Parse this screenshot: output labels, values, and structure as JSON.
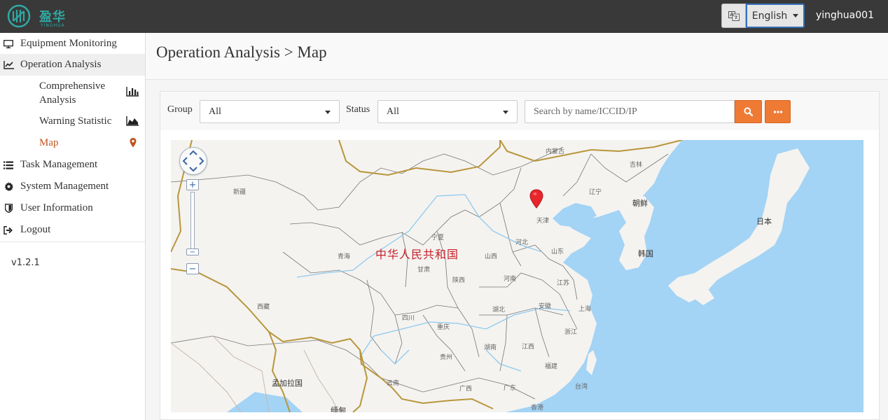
{
  "header": {
    "logo_text": "盈华",
    "logo_sub": "YINGHUA",
    "language": "English",
    "username": "yinghua001"
  },
  "sidebar": {
    "items": [
      {
        "label": "Equipment Monitoring",
        "icon": "monitor-icon"
      },
      {
        "label": "Operation Analysis",
        "icon": "line-chart-icon"
      },
      {
        "label": "Task Management",
        "icon": "list-icon"
      },
      {
        "label": "System Management",
        "icon": "gear-icon"
      },
      {
        "label": "User Information",
        "icon": "shield-icon"
      },
      {
        "label": "Logout",
        "icon": "sign-out-icon"
      }
    ],
    "sub_items": [
      {
        "label": "Comprehensive Analysis",
        "icon": "bar-chart-icon"
      },
      {
        "label": "Warning Statistic",
        "icon": "area-chart-icon"
      },
      {
        "label": "Map",
        "icon": "map-marker-icon"
      }
    ],
    "version": "v1.2.1"
  },
  "page": {
    "title": "Operation Analysis > Map"
  },
  "filters": {
    "group_label": "Group",
    "group_value": "All",
    "status_label": "Status",
    "status_value": "All",
    "search_placeholder": "Search by name/ICCID/IP"
  },
  "map": {
    "country_label": "中华人民共和国",
    "labels": {
      "neimenggu": "内蒙古",
      "jilin": "吉林",
      "liaoning": "辽宁",
      "chaoxian": "朝鲜",
      "xinjiang": "新疆",
      "tianjin": "天津",
      "ningxia": "宁夏",
      "riben": "日本",
      "qinghai": "青海",
      "hebei": "河北",
      "shandong": "山东",
      "hanguo": "韩国",
      "shanxi": "山西",
      "gansu": "甘肃",
      "shaanxi": "陕西",
      "henan": "河南",
      "jiangsu": "江苏",
      "xizang": "西藏",
      "anhui": "安徽",
      "hubei": "湖北",
      "shanghai": "上海",
      "sichuan": "四川",
      "chongqing": "重庆",
      "zhejiang": "浙江",
      "hunan": "湖南",
      "jiangxi": "江西",
      "guizhou": "贵州",
      "fujian": "福建",
      "mengjiala": "孟加拉国",
      "yunnan": "云南",
      "guangxi": "广西",
      "guangdong": "广东",
      "taiwan": "台湾",
      "xianggang": "香港",
      "miandian": "缅甸"
    }
  },
  "colors": {
    "topbar": "#393939",
    "accent_orange": "#ef7a34",
    "active_link": "#c0561f",
    "sea": "#a3d3f5",
    "land": "#f4f3f0",
    "marker": "#e8262c"
  }
}
